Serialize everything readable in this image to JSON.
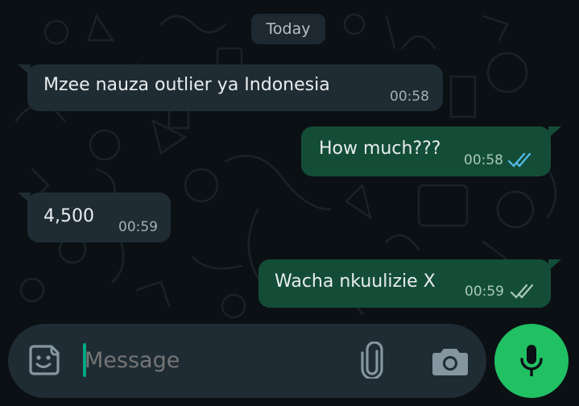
{
  "chat": {
    "date_chip": "Today",
    "messages": [
      {
        "direction": "incoming",
        "text": "Mzee nauza outlier ya Indonesia",
        "time": "00:58"
      },
      {
        "direction": "outgoing",
        "text": "How much???",
        "time": "00:58",
        "status": "read"
      },
      {
        "direction": "incoming",
        "text": "4,500",
        "time": "00:59"
      },
      {
        "direction": "outgoing",
        "text": "Wacha nkuulizie X",
        "time": "00:59",
        "status": "delivered"
      }
    ]
  },
  "composer": {
    "placeholder": "Message",
    "icons": [
      "sticker-icon",
      "attach-icon",
      "camera-icon",
      "mic-icon"
    ]
  },
  "colors": {
    "background": "#0b1014",
    "incoming_bubble": "#1f2c33",
    "outgoing_bubble": "#144d37",
    "read_ticks": "#53bdeb",
    "mic_button": "#21c063"
  }
}
